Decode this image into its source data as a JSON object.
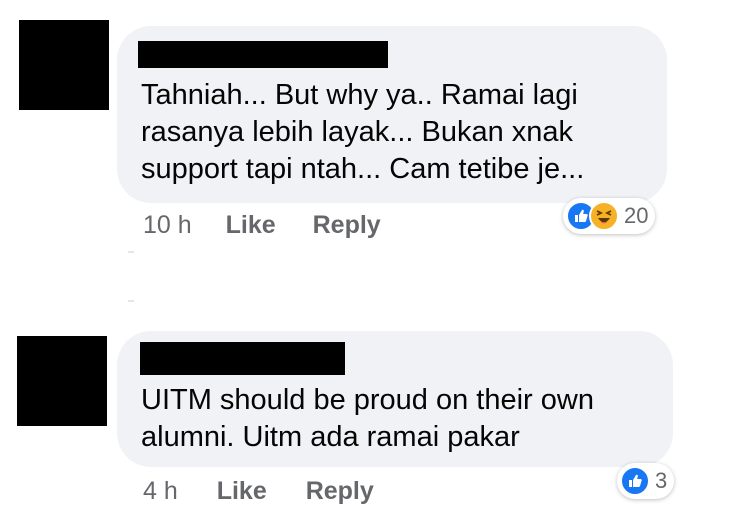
{
  "comments": [
    {
      "text_lines": [
        "Tahniah... But why ya.. Ramai lagi",
        "rasanya lebih layak... Bukan xnak",
        "support tapi ntah... Cam tetibe je..."
      ],
      "time": "10 h",
      "like_label": "Like",
      "reply_label": "Reply",
      "reaction_icons": [
        "like-icon",
        "haha-icon"
      ],
      "reaction_count": "20"
    },
    {
      "text_lines": [
        "UITM should be proud on their own",
        "alumni. Uitm ada ramai pakar"
      ],
      "time": "4 h",
      "like_label": "Like",
      "reply_label": "Reply",
      "reaction_icons": [
        "like-icon"
      ],
      "reaction_count": "3"
    }
  ],
  "colors": {
    "bubble": "#f0f2f5",
    "like_blue": "#1877f2",
    "haha_yellow": "#f7b125",
    "meta_gray": "#65676b",
    "redaction": "#000000"
  }
}
